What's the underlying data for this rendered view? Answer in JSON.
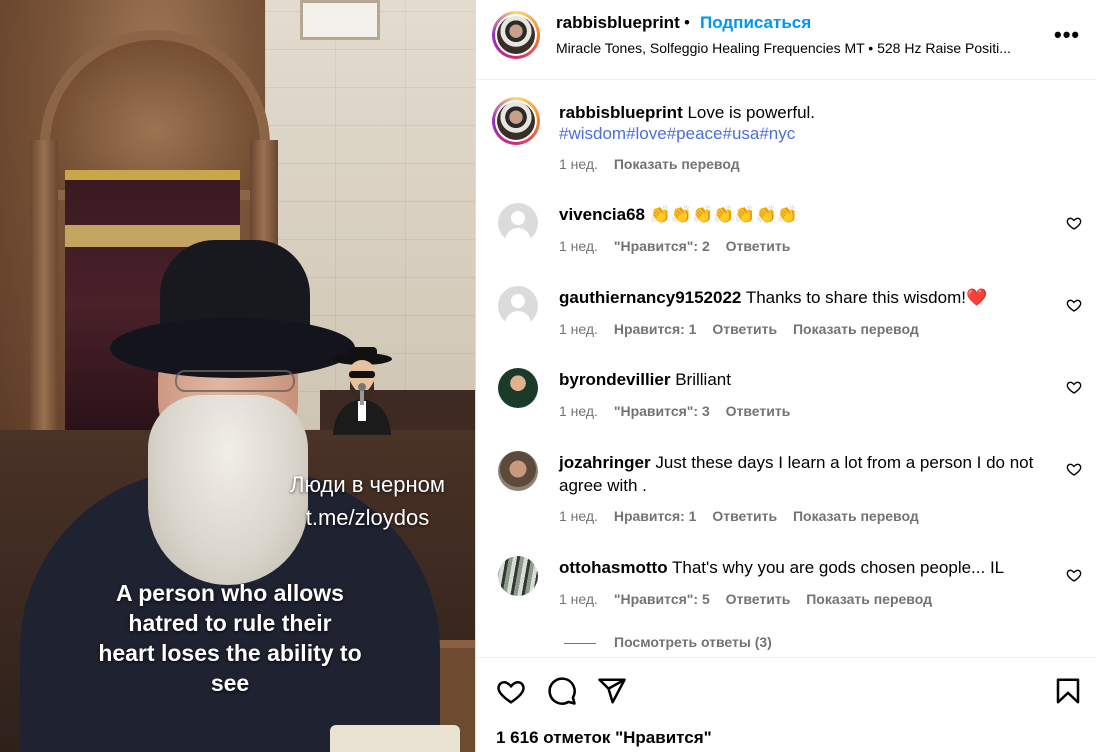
{
  "media": {
    "watermark_name": "Люди в черном",
    "watermark_link": "t.me/zloydos",
    "caption_lines": [
      "A person who allows",
      "hatred to rule their",
      "heart loses the ability to",
      "see"
    ]
  },
  "header": {
    "username": "rabbisblueprint",
    "separator": "•",
    "follow_label": "Подписаться",
    "audio": "Miracle Tones, Solfeggio Healing Frequencies MT • 528 Hz Raise Positi...",
    "more_label": "•••"
  },
  "caption": {
    "username": "rabbisblueprint",
    "text": "Love is powerful.",
    "hashtags": "#wisdom#love#peace#usa#nyc",
    "time": "1 нед.",
    "translate": "Показать перевод"
  },
  "comments": [
    {
      "username": "vivencia68",
      "text": "👏👏👏👏👏👏👏",
      "time": "1 нед.",
      "likes": "\"Нравится\": 2",
      "reply": "Ответить",
      "translate": ""
    },
    {
      "username": "gauthiernancy9152022",
      "text": "Thanks to share this wisdom!❤️",
      "time": "1 нед.",
      "likes": "Нравится: 1",
      "reply": "Ответить",
      "translate": "Показать перевод"
    },
    {
      "username": "byrondevillier",
      "text": "Brilliant",
      "time": "1 нед.",
      "likes": "\"Нравится\": 3",
      "reply": "Ответить",
      "translate": ""
    },
    {
      "username": "jozahringer",
      "text": "Just these days I learn a lot from a person I do not agree with .",
      "time": "1 нед.",
      "likes": "Нравится: 1",
      "reply": "Ответить",
      "translate": "Показать перевод"
    },
    {
      "username": "ottohasmotto",
      "text": "That's why you are gods chosen people... IL",
      "time": "1 нед.",
      "likes": "\"Нравится\": 5",
      "reply": "Ответить",
      "translate": "Показать перевод"
    }
  ],
  "view_replies": "Посмотреть ответы (3)",
  "likes_count": "1 616 отметок \"Нравится\"",
  "icons": [
    "heart-icon",
    "comment-icon",
    "share-icon",
    "bookmark-icon",
    "more-icon"
  ],
  "colors": {
    "link_blue": "#0095f6",
    "hashtag_blue": "#4e6ed8",
    "muted": "#737373",
    "heart_red": "#e0241c"
  }
}
